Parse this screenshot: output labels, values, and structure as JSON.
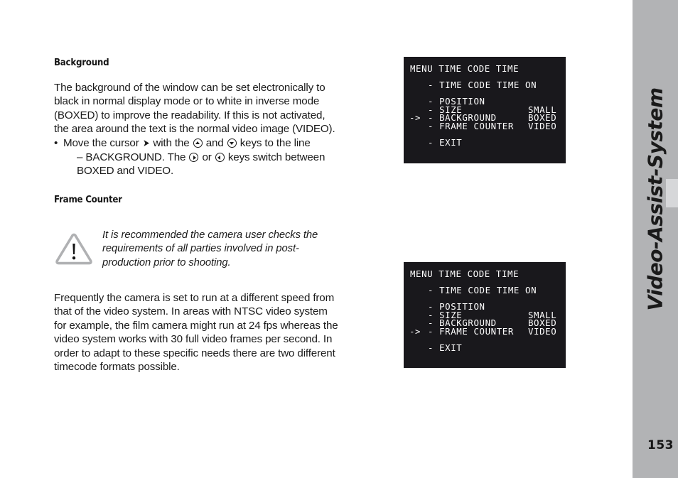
{
  "document": {
    "page_number": "153",
    "sidebar_title": "Video-Assist-System"
  },
  "sections": [
    {
      "heading": "Background",
      "paragraph": "The background of the window can be set electronically to black in normal display mode or to white  in inverse mode (BOXED) to improve the readability. If this is not activated, the area around the text is the normal video image (VIDEO).",
      "bullet": {
        "dot": "•",
        "part1": "Move the cursor",
        "cursor_glyph": "➤",
        "part2": "with the",
        "key_up": "up-arrow-key",
        "part3": "and",
        "key_down": "down-arrow-key",
        "part4": "keys to the line",
        "part5": "– BACKGROUND. The",
        "key_right": "right-arrow-key",
        "part6": "or",
        "key_left": "left-arrow-key",
        "part7": "keys switch between BOXED and VIDEO."
      }
    },
    {
      "heading": "Frame Counter",
      "note_icon": "warning-triangle-icon",
      "note": "It is recommended the camera user checks the requirements of all parties involved in post-production prior to shooting.",
      "paragraph": "Frequently the camera is set to run at a different speed from that of the video system. In areas with NTSC video system for example, the film camera might run at 24 fps whereas the video system works with 30 full video frames per second. In order to adapt to these specific needs there are two different timecode formats possible."
    }
  ],
  "menu_screens": [
    {
      "title": "MENU TIME CODE TIME",
      "rows": [
        {
          "cursor": "",
          "label": "- TIME CODE TIME ON",
          "value": ""
        },
        {
          "spacer": true
        },
        {
          "cursor": "",
          "label": "- POSITION",
          "value": ""
        },
        {
          "cursor": "",
          "label": "- SIZE",
          "value": "SMALL"
        },
        {
          "cursor": "->",
          "label": "- BACKGROUND",
          "value": "BOXED"
        },
        {
          "cursor": "",
          "label": "- FRAME COUNTER",
          "value": "VIDEO"
        },
        {
          "spacer": true
        },
        {
          "cursor": "",
          "label": "- EXIT",
          "value": ""
        }
      ]
    },
    {
      "title": "MENU TIME CODE TIME",
      "rows": [
        {
          "cursor": "",
          "label": "- TIME CODE TIME ON",
          "value": ""
        },
        {
          "spacer": true
        },
        {
          "cursor": "",
          "label": "- POSITION",
          "value": ""
        },
        {
          "cursor": "",
          "label": "- SIZE",
          "value": "SMALL"
        },
        {
          "cursor": "",
          "label": "- BACKGROUND",
          "value": "BOXED"
        },
        {
          "cursor": "->",
          "label": "- FRAME COUNTER",
          "value": "VIDEO"
        },
        {
          "spacer": true
        },
        {
          "cursor": "",
          "label": "- EXIT",
          "value": ""
        }
      ]
    }
  ],
  "colors": {
    "sidebar": "#b2b3b5",
    "sidebar_tab": "#d6d7d9",
    "screen_bg": "#19181c",
    "screen_fg": "#ffffff",
    "text": "#1b1b1b"
  }
}
